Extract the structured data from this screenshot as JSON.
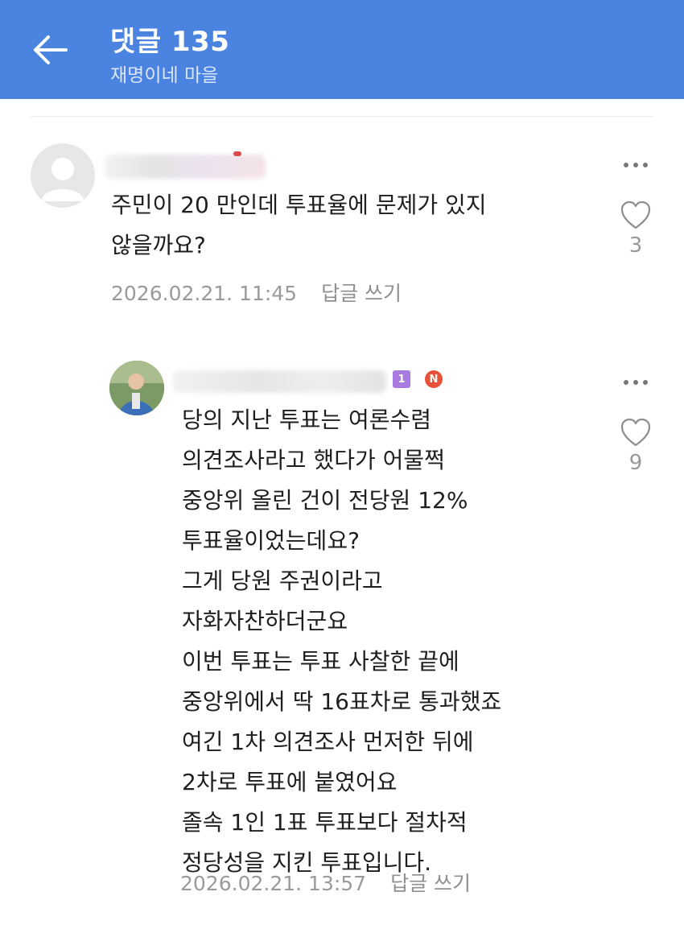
{
  "header": {
    "title": "댓글 135",
    "subtitle": "재명이네 마을"
  },
  "colors": {
    "header_bg": "#4a83e0",
    "new_badge": "#e8503a",
    "level_badge": "#a97be0"
  },
  "comments": [
    {
      "text": "주민이 20 만인데 투표율에 문제가 있지\n않을까요?",
      "timestamp": "2026.02.21. 11:45",
      "reply_label": "답글 쓰기",
      "like_count": "3",
      "nickname_blurred": true
    },
    {
      "text": "당의 지난 투표는 여론수렴\n의견조사라고 했다가 어물쩍\n중앙위 올린 건이 전당원 12%\n투표율이었는데요?\n그게 당원 주권이라고\n자화자찬하더군요\n이번 투표는 투표 사찰한 끝에\n중앙위에서 딱 16표차로 통과했죠\n여긴 1차 의견조사 먼저한 뒤에\n2차로 투표에 붙였어요\n졸속 1인 1표 투표보다 절차적\n정당성을 지킨 투표입니다.",
      "timestamp": "2026.02.21. 13:57",
      "reply_label": "답글 쓰기",
      "like_count": "9",
      "level_badge": "1",
      "new_badge": "N",
      "nickname_blurred": true
    }
  ],
  "icons": [
    "back-arrow-icon",
    "more-dots-icon",
    "heart-icon",
    "default-avatar-icon"
  ]
}
